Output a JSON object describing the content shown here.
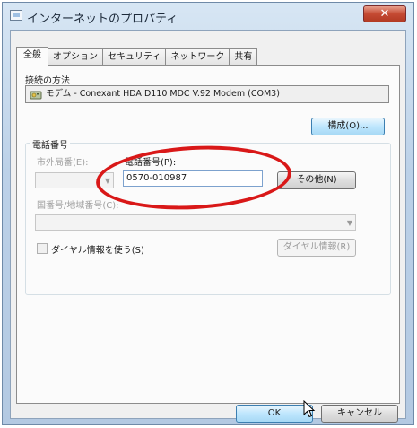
{
  "window": {
    "title": "インターネットのプロパティ",
    "close_glyph": "✕"
  },
  "tabs": [
    {
      "label": "全般",
      "active": true
    },
    {
      "label": "オプション",
      "active": false
    },
    {
      "label": "セキュリティ",
      "active": false
    },
    {
      "label": "ネットワーク",
      "active": false
    },
    {
      "label": "共有",
      "active": false
    }
  ],
  "connection": {
    "label": "接続の方法",
    "value": "モデム - Conexant HDA D110 MDC V.92 Modem (COM3)",
    "configure_button": "構成(O)..."
  },
  "phone_group": {
    "title": "電話番号",
    "area_code_label": "市外局番(E):",
    "area_code_value": "",
    "phone_label": "電話番号(P):",
    "phone_value": "0570-010987",
    "other_button": "その他(N)",
    "country_label": "国番号/地域番号(C):",
    "country_value": "",
    "use_dialing_rules_label": "ダイヤル情報を使う(S)",
    "use_dialing_rules_checked": false,
    "dialing_rules_button": "ダイヤル情報(R)"
  },
  "footer": {
    "ok_button": "OK",
    "cancel_button": "キャンセル"
  },
  "colors": {
    "annotation_red": "#d91818",
    "focus_blue": "#3c7fb1"
  }
}
